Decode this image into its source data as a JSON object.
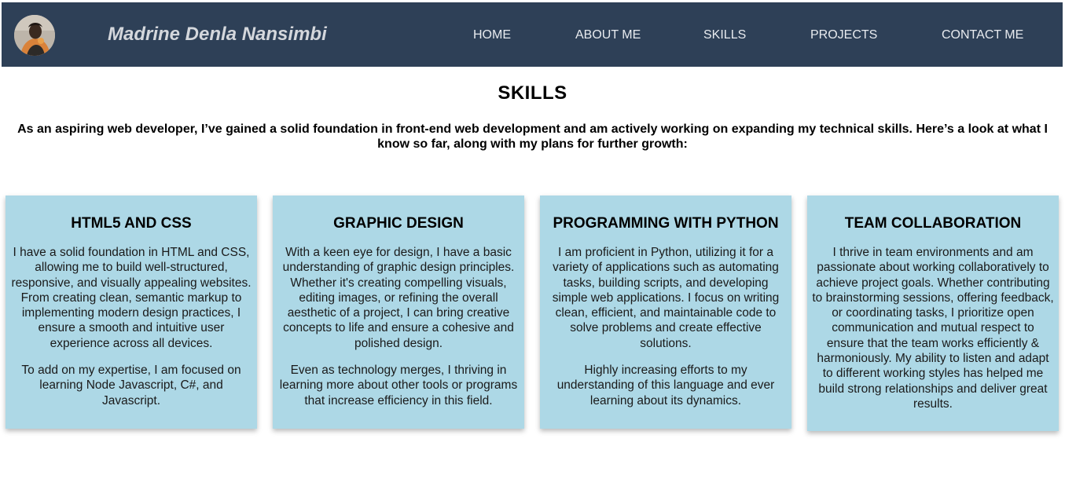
{
  "header": {
    "brand_name": "Madrine Denla Nansimbi",
    "nav": [
      {
        "label": "HOME"
      },
      {
        "label": "ABOUT ME"
      },
      {
        "label": "SKILLS"
      },
      {
        "label": "PROJECTS"
      },
      {
        "label": "CONTACT ME"
      }
    ]
  },
  "main": {
    "title": "SKILLS",
    "intro": "As an aspiring web developer, I’ve gained a solid foundation in front-end web development and am actively working on expanding my technical skills. Here’s a look at what I know so far, along with my plans for further growth:",
    "cards": [
      {
        "title": "HTML5 AND CSS",
        "paragraphs": [
          "I have a solid foundation in HTML and CSS, allowing me to build well-structured, responsive, and visually appealing websites. From creating clean, semantic markup to implementing modern design practices, I ensure a smooth and intuitive user experience across all devices.",
          "To add on my expertise, I am focused on learning Node Javascript, C#, and Javascript."
        ]
      },
      {
        "title": "GRAPHIC DESIGN",
        "paragraphs": [
          "With a keen eye for design, I have a basic understanding of graphic design principles. Whether it's creating compelling visuals, editing images, or refining the overall aesthetic of a project, I can bring creative concepts to life and ensure a cohesive and polished design.",
          "Even as technology merges, I thriving in learning more about other tools or programs that increase efficiency in this field."
        ]
      },
      {
        "title": "PROGRAMMING WITH PYTHON",
        "paragraphs": [
          "I am proficient in Python, utilizing it for a variety of applications such as automating tasks, building scripts, and developing simple web applications. I focus on writing clean, efficient, and maintainable code to solve problems and create effective solutions.",
          "Highly increasing efforts to my understanding of this language and ever learning about its dynamics."
        ]
      },
      {
        "title": "TEAM COLLABORATION",
        "paragraphs": [
          "I thrive in team environments and am passionate about working collaboratively to achieve project goals. Whether contributing to brainstorming sessions, offering feedback, or coordinating tasks, I prioritize open communication and mutual respect to ensure that the team works efficiently & harmoniously. My ability to listen and adapt to different working styles has helped me build strong relationships and deliver great results."
        ]
      }
    ]
  },
  "colors": {
    "navbar_bg": "#2e4057",
    "card_bg": "#add8e6"
  }
}
